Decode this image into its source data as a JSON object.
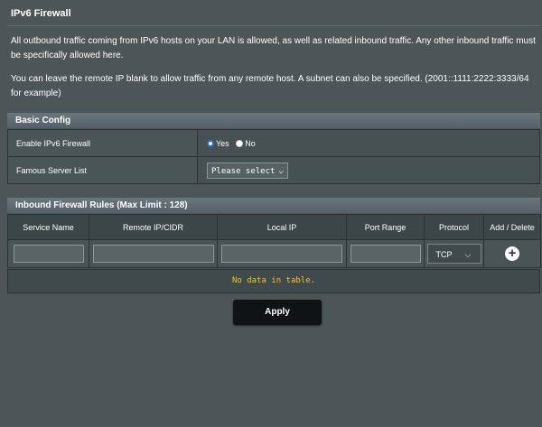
{
  "page": {
    "title": "IPv6 Firewall",
    "description_1": "All outbound traffic coming from IPv6 hosts on your LAN is allowed, as well as related inbound traffic. Any other inbound traffic must be specifically allowed here.",
    "description_2": "You can leave the remote IP blank to allow traffic from any remote host. A subnet can also be specified. (2001::1111:2222:3333/64 for example)"
  },
  "basic_config": {
    "header": "Basic Config",
    "enable_label": "Enable IPv6 Firewall",
    "enable_options": [
      {
        "label": "Yes",
        "selected": true
      },
      {
        "label": "No",
        "selected": false
      }
    ],
    "famous_server_label": "Famous Server List",
    "famous_server_value": "Please select"
  },
  "rules": {
    "header": "Inbound Firewall Rules (Max Limit : 128)",
    "columns": [
      "Service Name",
      "Remote IP/CIDR",
      "Local IP",
      "Port Range",
      "Protocol",
      "Add / Delete"
    ],
    "protocol_value": "TCP",
    "empty_message": "No data in table."
  },
  "apply_label": "Apply"
}
